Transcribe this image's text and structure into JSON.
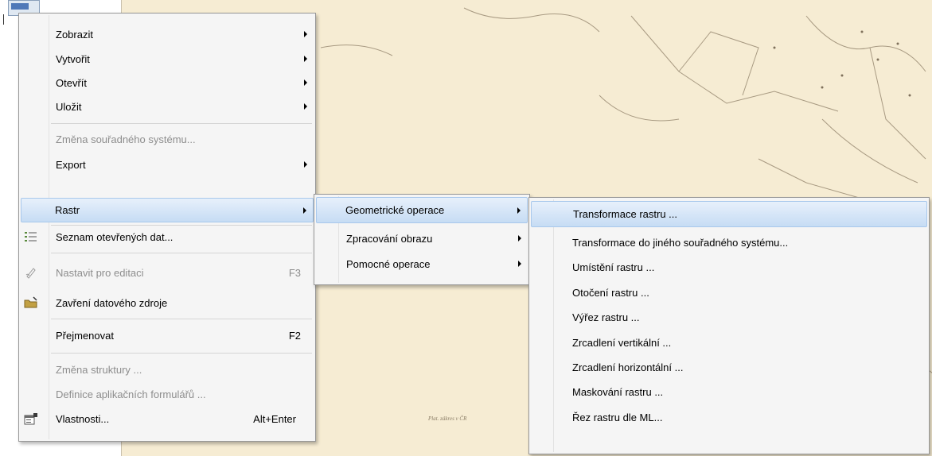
{
  "main_menu": {
    "items": [
      {
        "label": "Zobrazit",
        "submenu": true,
        "enabled": true
      },
      {
        "label": "Vytvořit",
        "submenu": true,
        "enabled": true
      },
      {
        "label": "Otevřít",
        "submenu": true,
        "enabled": true
      },
      {
        "label": "Uložit",
        "submenu": true,
        "enabled": true
      },
      {
        "label": "Změna souřadného systému...",
        "submenu": false,
        "enabled": false
      },
      {
        "label": "Export",
        "submenu": true,
        "enabled": true
      },
      {
        "label": "Rastr",
        "submenu": true,
        "enabled": true,
        "highlighted": true
      },
      {
        "label": "Seznam otevřených dat...",
        "icon": "list-icon",
        "enabled": true
      },
      {
        "label": "Nastavit pro editaci",
        "shortcut": "F3",
        "icon": "edit-pen-icon",
        "enabled": false
      },
      {
        "label": "Zavření datového zdroje",
        "icon": "folder-close-icon",
        "enabled": true
      },
      {
        "label": "Přejmenovat",
        "shortcut": "F2",
        "enabled": true
      },
      {
        "label": "Změna struktury ...",
        "enabled": false
      },
      {
        "label": "Definice aplikačních formulářů ...",
        "enabled": false
      },
      {
        "label": "Vlastnosti...",
        "shortcut": "Alt+Enter",
        "icon": "properties-icon",
        "enabled": true
      }
    ]
  },
  "raster_submenu": {
    "items": [
      {
        "label": "Geometrické operace",
        "submenu": true,
        "highlighted": true
      },
      {
        "label": "Zpracování obrazu",
        "submenu": true
      },
      {
        "label": "Pomocné operace",
        "submenu": true
      }
    ]
  },
  "geometry_submenu": {
    "items": [
      {
        "label": "Transformace rastru ...",
        "highlighted": true
      },
      {
        "label": "Transformace do jiného souřadného systému..."
      },
      {
        "label": "Umístění rastru ..."
      },
      {
        "label": "Otočení rastru ..."
      },
      {
        "label": "Výřez rastru ..."
      },
      {
        "label": "Zrcadlení vertikální ..."
      },
      {
        "label": "Zrcadlení horizontální ..."
      },
      {
        "label": "Maskování rastru ..."
      },
      {
        "label": "Řez rastru dle ML..."
      }
    ]
  },
  "map": {
    "note": "Plat. zákres v ČR"
  },
  "colors": {
    "map_background": "#f6ecd3",
    "menu_background": "#f5f5f5",
    "highlight": "#c6dcf4",
    "disabled_text": "#8d8d8d"
  }
}
